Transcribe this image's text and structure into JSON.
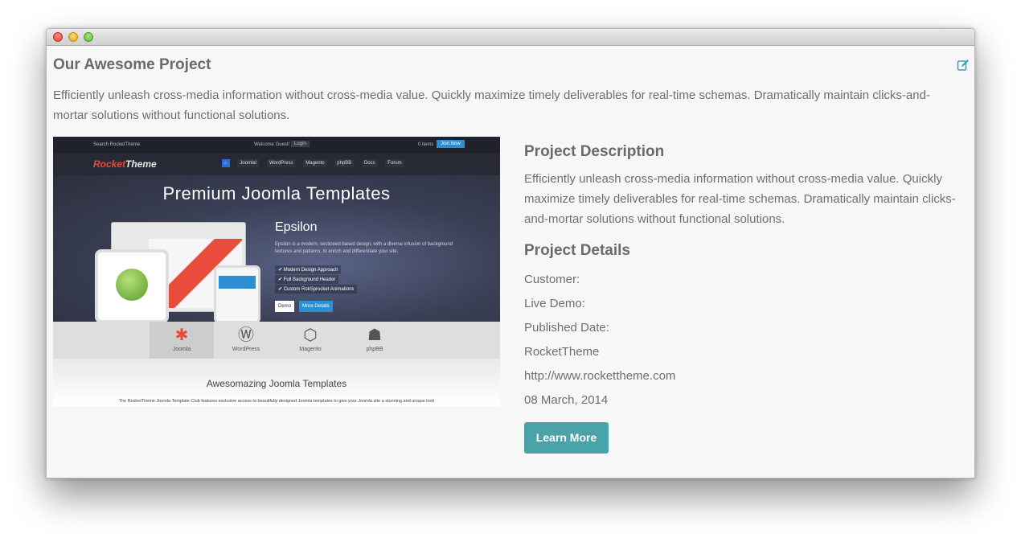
{
  "window": {
    "title": ""
  },
  "project": {
    "title": "Our Awesome Project",
    "intro": "Efficiently unleash cross-media information without cross-media value. Quickly maximize timely deliverables for real-time schemas. Dramatically maintain clicks-and-mortar solutions without functional solutions.",
    "edit_icon": "edit-icon"
  },
  "screenshot": {
    "topbar": {
      "search": "Search RocketTheme",
      "welcome": "Welcome Guest!",
      "login": "Login",
      "cart": "0 items",
      "join": "Join Now"
    },
    "logo": {
      "a": "Rocket",
      "b": "Theme"
    },
    "nav": [
      "Joomla!",
      "WordPress",
      "Magento",
      "phpBB",
      "Docs",
      "Forum"
    ],
    "hero_title": "Premium Joomla Templates",
    "theme_name": "Epsilon",
    "theme_text": "Epsilon is a modern, sectioned based design, with a diverse infusion of background textures and patterns, to enrich and differentiate your site.",
    "features": [
      "Modern Design Approach",
      "Full Background Header",
      "Custom RokSprocket Animations"
    ],
    "demo_btn": "Demo",
    "details_btn": "More Details",
    "cms": [
      "Joomla",
      "WordPress",
      "Magento",
      "phpBB"
    ],
    "footer_title": "Awesomazing Joomla Templates",
    "footer_text": "The RocketTheme Joomla Template Club features exclusive access to beautifully designed Joomla templates to give your Joomla site a stunning and unique look"
  },
  "details": {
    "desc_heading": "Project Description",
    "desc_text": "Efficiently unleash cross-media information without cross-media value. Quickly maximize timely deliverables for real-time schemas. Dramatically maintain clicks-and-mortar solutions without functional solutions.",
    "details_heading": "Project Details",
    "rows": [
      "Customer:",
      "Live Demo:",
      "Published Date:",
      "RocketTheme",
      "http://www.rockettheme.com",
      "08 March, 2014"
    ],
    "button": "Learn More"
  },
  "colors": {
    "accent": "#4aa3a8",
    "text": "#6f6f6f",
    "heading": "#6a6a6a"
  }
}
